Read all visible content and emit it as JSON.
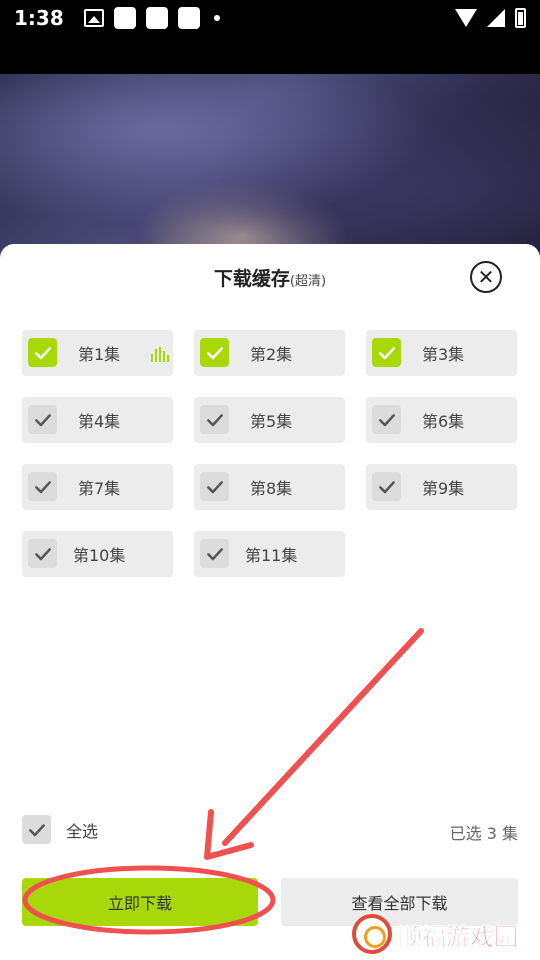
{
  "status_bar": {
    "time": "1:38"
  },
  "sheet": {
    "title": "下载缓存",
    "title_sub": "(超清)",
    "close_glyph": "✕"
  },
  "episodes": [
    {
      "label": "第1集",
      "checked": true,
      "playing": true
    },
    {
      "label": "第2集",
      "checked": true
    },
    {
      "label": "第3集",
      "checked": true
    },
    {
      "label": "第4集",
      "checked": false
    },
    {
      "label": "第5集",
      "checked": false
    },
    {
      "label": "第6集",
      "checked": false
    },
    {
      "label": "第7集",
      "checked": false
    },
    {
      "label": "第8集",
      "checked": false
    },
    {
      "label": "第9集",
      "checked": false
    },
    {
      "label": "第10集",
      "checked": false
    },
    {
      "label": "第11集",
      "checked": false
    }
  ],
  "footer": {
    "select_all_label": "全选",
    "selected_count": "已选 3 集",
    "download_now": "立即下载",
    "view_all_downloads": "查看全部下载"
  },
  "colors": {
    "accent": "#a8d80a",
    "annotation": "#f05050",
    "watermark": "#e23a3a"
  },
  "watermark": {
    "text": "顺福游戏园"
  }
}
